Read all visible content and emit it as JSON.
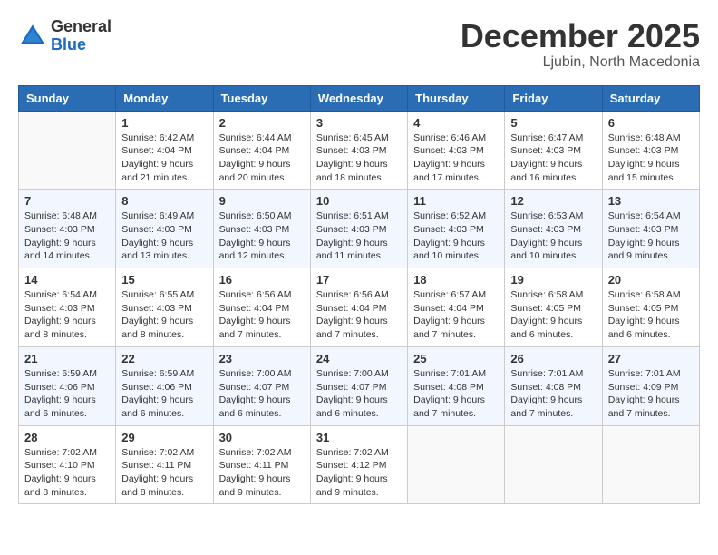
{
  "logo": {
    "general": "General",
    "blue": "Blue"
  },
  "header": {
    "month": "December 2025",
    "location": "Ljubin, North Macedonia"
  },
  "weekdays": [
    "Sunday",
    "Monday",
    "Tuesday",
    "Wednesday",
    "Thursday",
    "Friday",
    "Saturday"
  ],
  "weeks": [
    [
      {
        "day": "",
        "info": ""
      },
      {
        "day": "1",
        "info": "Sunrise: 6:42 AM\nSunset: 4:04 PM\nDaylight: 9 hours\nand 21 minutes."
      },
      {
        "day": "2",
        "info": "Sunrise: 6:44 AM\nSunset: 4:04 PM\nDaylight: 9 hours\nand 20 minutes."
      },
      {
        "day": "3",
        "info": "Sunrise: 6:45 AM\nSunset: 4:03 PM\nDaylight: 9 hours\nand 18 minutes."
      },
      {
        "day": "4",
        "info": "Sunrise: 6:46 AM\nSunset: 4:03 PM\nDaylight: 9 hours\nand 17 minutes."
      },
      {
        "day": "5",
        "info": "Sunrise: 6:47 AM\nSunset: 4:03 PM\nDaylight: 9 hours\nand 16 minutes."
      },
      {
        "day": "6",
        "info": "Sunrise: 6:48 AM\nSunset: 4:03 PM\nDaylight: 9 hours\nand 15 minutes."
      }
    ],
    [
      {
        "day": "7",
        "info": "Sunrise: 6:48 AM\nSunset: 4:03 PM\nDaylight: 9 hours\nand 14 minutes."
      },
      {
        "day": "8",
        "info": "Sunrise: 6:49 AM\nSunset: 4:03 PM\nDaylight: 9 hours\nand 13 minutes."
      },
      {
        "day": "9",
        "info": "Sunrise: 6:50 AM\nSunset: 4:03 PM\nDaylight: 9 hours\nand 12 minutes."
      },
      {
        "day": "10",
        "info": "Sunrise: 6:51 AM\nSunset: 4:03 PM\nDaylight: 9 hours\nand 11 minutes."
      },
      {
        "day": "11",
        "info": "Sunrise: 6:52 AM\nSunset: 4:03 PM\nDaylight: 9 hours\nand 10 minutes."
      },
      {
        "day": "12",
        "info": "Sunrise: 6:53 AM\nSunset: 4:03 PM\nDaylight: 9 hours\nand 10 minutes."
      },
      {
        "day": "13",
        "info": "Sunrise: 6:54 AM\nSunset: 4:03 PM\nDaylight: 9 hours\nand 9 minutes."
      }
    ],
    [
      {
        "day": "14",
        "info": "Sunrise: 6:54 AM\nSunset: 4:03 PM\nDaylight: 9 hours\nand 8 minutes."
      },
      {
        "day": "15",
        "info": "Sunrise: 6:55 AM\nSunset: 4:03 PM\nDaylight: 9 hours\nand 8 minutes."
      },
      {
        "day": "16",
        "info": "Sunrise: 6:56 AM\nSunset: 4:04 PM\nDaylight: 9 hours\nand 7 minutes."
      },
      {
        "day": "17",
        "info": "Sunrise: 6:56 AM\nSunset: 4:04 PM\nDaylight: 9 hours\nand 7 minutes."
      },
      {
        "day": "18",
        "info": "Sunrise: 6:57 AM\nSunset: 4:04 PM\nDaylight: 9 hours\nand 7 minutes."
      },
      {
        "day": "19",
        "info": "Sunrise: 6:58 AM\nSunset: 4:05 PM\nDaylight: 9 hours\nand 6 minutes."
      },
      {
        "day": "20",
        "info": "Sunrise: 6:58 AM\nSunset: 4:05 PM\nDaylight: 9 hours\nand 6 minutes."
      }
    ],
    [
      {
        "day": "21",
        "info": "Sunrise: 6:59 AM\nSunset: 4:06 PM\nDaylight: 9 hours\nand 6 minutes."
      },
      {
        "day": "22",
        "info": "Sunrise: 6:59 AM\nSunset: 4:06 PM\nDaylight: 9 hours\nand 6 minutes."
      },
      {
        "day": "23",
        "info": "Sunrise: 7:00 AM\nSunset: 4:07 PM\nDaylight: 9 hours\nand 6 minutes."
      },
      {
        "day": "24",
        "info": "Sunrise: 7:00 AM\nSunset: 4:07 PM\nDaylight: 9 hours\nand 6 minutes."
      },
      {
        "day": "25",
        "info": "Sunrise: 7:01 AM\nSunset: 4:08 PM\nDaylight: 9 hours\nand 7 minutes."
      },
      {
        "day": "26",
        "info": "Sunrise: 7:01 AM\nSunset: 4:08 PM\nDaylight: 9 hours\nand 7 minutes."
      },
      {
        "day": "27",
        "info": "Sunrise: 7:01 AM\nSunset: 4:09 PM\nDaylight: 9 hours\nand 7 minutes."
      }
    ],
    [
      {
        "day": "28",
        "info": "Sunrise: 7:02 AM\nSunset: 4:10 PM\nDaylight: 9 hours\nand 8 minutes."
      },
      {
        "day": "29",
        "info": "Sunrise: 7:02 AM\nSunset: 4:11 PM\nDaylight: 9 hours\nand 8 minutes."
      },
      {
        "day": "30",
        "info": "Sunrise: 7:02 AM\nSunset: 4:11 PM\nDaylight: 9 hours\nand 9 minutes."
      },
      {
        "day": "31",
        "info": "Sunrise: 7:02 AM\nSunset: 4:12 PM\nDaylight: 9 hours\nand 9 minutes."
      },
      {
        "day": "",
        "info": ""
      },
      {
        "day": "",
        "info": ""
      },
      {
        "day": "",
        "info": ""
      }
    ]
  ]
}
